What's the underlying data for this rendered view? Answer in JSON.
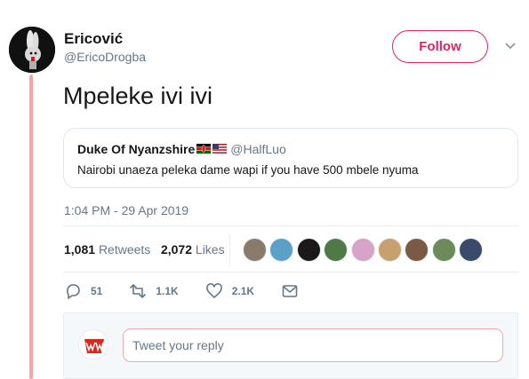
{
  "author": {
    "display_name": "Ericović",
    "handle": "@EricoDrogba"
  },
  "header": {
    "follow_label": "Follow",
    "caret_icon": "chevron-down-icon"
  },
  "tweet": {
    "text": "Mpeleke ivi ivi",
    "timestamp": "1:04 PM - 29 Apr 2019"
  },
  "quote": {
    "name": "Duke Of Nyanzshire",
    "flags": [
      "kenya-flag-icon",
      "usa-flag-icon"
    ],
    "handle": "@HalfLuo",
    "text": "Nairobi unaeza peleka dame wapi if you have 500 mbele nyuma"
  },
  "stats": {
    "retweets_count": "1,081",
    "retweets_label": "Retweets",
    "likes_count": "2,072",
    "likes_label": "Likes"
  },
  "likers": [
    {
      "color": "#8a7a6a"
    },
    {
      "color": "#5aa0c8"
    },
    {
      "color": "#1a1a1a"
    },
    {
      "color": "#4f7a46"
    },
    {
      "color": "#d8a3c8"
    },
    {
      "color": "#c8a070"
    },
    {
      "color": "#7b5a45"
    },
    {
      "color": "#6d8a5a"
    },
    {
      "color": "#3a4a6a"
    }
  ],
  "actions": {
    "reply_count": "51",
    "retweet_count": "1.1K",
    "like_count": "2.1K"
  },
  "reply": {
    "placeholder": "Tweet your reply"
  },
  "colors": {
    "accent": "#e0245e",
    "thread_line": "#f5a7a5",
    "muted": "#657786"
  }
}
